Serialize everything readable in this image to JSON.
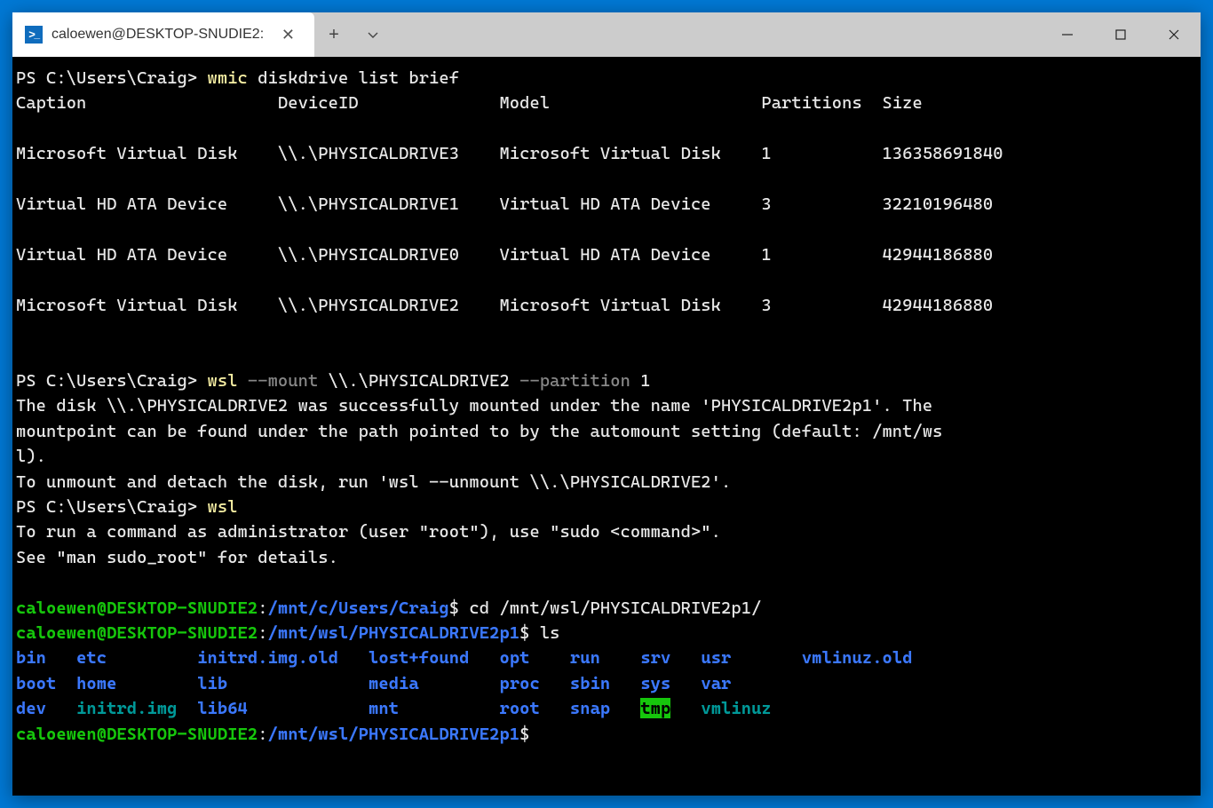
{
  "titlebar": {
    "tab_title": "caloewen@DESKTOP-SNUDIE2:",
    "newtab": "+",
    "dropdown": "⌄",
    "close": "✕"
  },
  "prompt": {
    "ps": "PS C:\\Users\\Craig>",
    "cmd1_bin": "wmic",
    "cmd1_rest": " diskdrive list brief",
    "cmd2_bin": "wsl",
    "cmd2_flag1": "--mount",
    "cmd2_arg1": " \\\\.\\PHYSICALDRIVE2 ",
    "cmd2_flag2": "--partition",
    "cmd2_arg2": " 1",
    "cmd3_bin": "wsl"
  },
  "table": {
    "headers": {
      "caption": "Caption",
      "deviceid": "DeviceID",
      "model": "Model",
      "partitions": "Partitions",
      "size": "Size"
    },
    "rows": [
      {
        "caption": "Microsoft Virtual Disk",
        "deviceid": "\\\\.\\PHYSICALDRIVE3",
        "model": "Microsoft Virtual Disk",
        "partitions": "1",
        "size": "136358691840"
      },
      {
        "caption": "Virtual HD ATA Device",
        "deviceid": "\\\\.\\PHYSICALDRIVE1",
        "model": "Virtual HD ATA Device",
        "partitions": "3",
        "size": "32210196480"
      },
      {
        "caption": "Virtual HD ATA Device",
        "deviceid": "\\\\.\\PHYSICALDRIVE0",
        "model": "Virtual HD ATA Device",
        "partitions": "1",
        "size": "42944186880"
      },
      {
        "caption": "Microsoft Virtual Disk",
        "deviceid": "\\\\.\\PHYSICALDRIVE2",
        "model": "Microsoft Virtual Disk",
        "partitions": "3",
        "size": "42944186880"
      }
    ]
  },
  "mount_output": {
    "l1": "The disk \\\\.\\PHYSICALDRIVE2 was successfully mounted under the name 'PHYSICALDRIVE2p1'. The ",
    "l2": "mountpoint can be found under the path pointed to by the automount setting (default: /mnt/ws",
    "l3": "l).",
    "l4": "To unmount and detach the disk, run 'wsl --unmount \\\\.\\PHYSICALDRIVE2'."
  },
  "sudo": {
    "l1": "To run a command as administrator (user \"root\"), use \"sudo <command>\".",
    "l2": "See \"man sudo_root\" for details."
  },
  "wsl": {
    "user_host": "caloewen@DESKTOP-SNUDIE2",
    "colon": ":",
    "path1": "/mnt/c/Users/Craig",
    "path2": "/mnt/wsl/PHYSICALDRIVE2p1",
    "dollar": "$",
    "cmd_cd": " cd /mnt/wsl/PHYSICALDRIVE2p1/",
    "cmd_ls": " ls"
  },
  "ls": {
    "r1": {
      "c1": "bin",
      "c2": "etc",
      "c3": "initrd.img.old",
      "c4": "lost+found",
      "c5": "opt",
      "c6": "run",
      "c7": "srv",
      "c8": "usr",
      "c9": "vmlinuz.old"
    },
    "r2": {
      "c1": "boot",
      "c2": "home",
      "c3": "lib",
      "c4": "media",
      "c5": "proc",
      "c6": "sbin",
      "c7": "sys",
      "c8": "var"
    },
    "r3": {
      "c1": "dev",
      "c2": "initrd.img",
      "c3": "lib64",
      "c4": "mnt",
      "c5": "root",
      "c6": "snap",
      "c7": "tmp",
      "c8": "vmlinuz"
    }
  },
  "cols": {
    "caption_w": 25,
    "deviceid_w": 21,
    "model_w": 25,
    "partitions_w": 12
  },
  "lscols": {
    "c1": 6,
    "c2": 12,
    "c3": 17,
    "c4": 13,
    "c5": 7,
    "c6": 7,
    "c7": 6,
    "c8": 10
  }
}
